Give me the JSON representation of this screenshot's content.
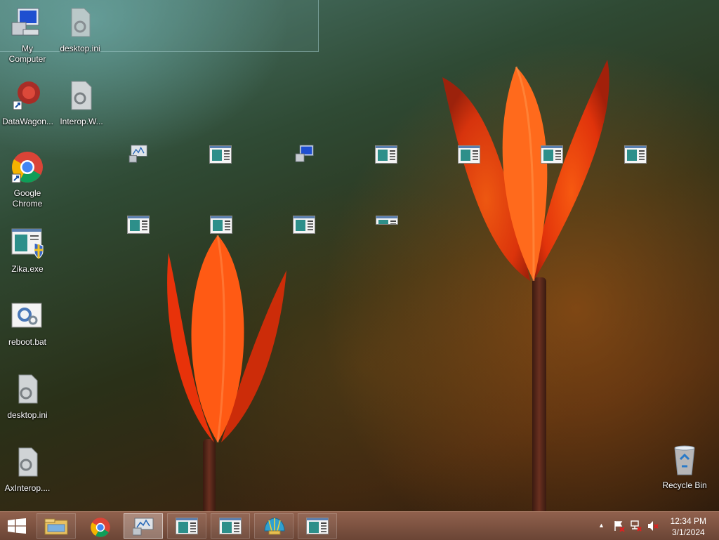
{
  "desktop": {
    "icons": [
      {
        "label": "My Computer"
      },
      {
        "label": "desktop.ini"
      },
      {
        "label": "DataWagon..."
      },
      {
        "label": "Interop.W..."
      },
      {
        "label": "Google Chrome"
      },
      {
        "label": "Zika.exe"
      },
      {
        "label": "reboot.bat"
      },
      {
        "label": "desktop.ini"
      },
      {
        "label": "AxInterop...."
      },
      {
        "label": "Recycle Bin"
      }
    ]
  },
  "taskbar": {
    "start_icon": "windows-logo-icon",
    "buttons": [
      "file-explorer-icon",
      "chrome-icon",
      "performance-monitor-icon",
      "app-window-icon",
      "app-window-icon",
      "shell-icon",
      "app-window-icon"
    ],
    "tray": {
      "icons": [
        "show-hidden-icons-chevron",
        "action-center-flag-icon",
        "network-icon",
        "volume-muted-icon"
      ],
      "time": "12:34 PM",
      "date": "3/1/2024"
    }
  },
  "colors": {
    "accent_teal": "#2d8f8a",
    "taskbar": "#8a5a48"
  }
}
